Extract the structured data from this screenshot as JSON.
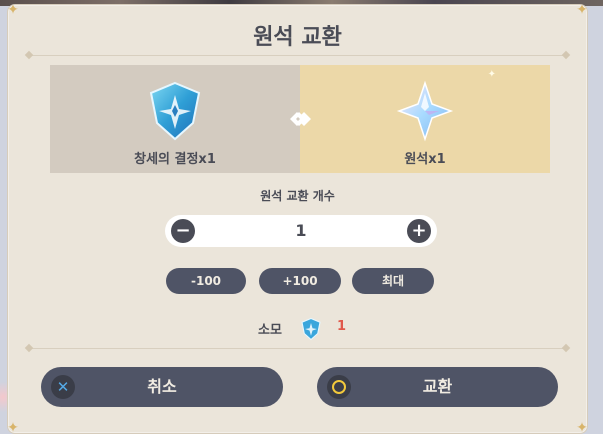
{
  "dialog": {
    "title": "원석 교환"
  },
  "exchange": {
    "from_item": {
      "label": "창세의 결정x1",
      "icon": "genesis-crystal-icon"
    },
    "arrow_icon": "exchange-arrow-icon",
    "to_item": {
      "label": "원석x1",
      "icon": "primogem-icon"
    }
  },
  "quantity": {
    "label": "원석 교환 개수",
    "value": "1",
    "minus_icon": "minus-icon",
    "plus_icon": "plus-icon"
  },
  "quick_buttons": [
    {
      "label": "-100"
    },
    {
      "label": "+100"
    },
    {
      "label": "최대"
    }
  ],
  "consume": {
    "label": "소모",
    "icon": "genesis-crystal-icon",
    "count": "1"
  },
  "actions": {
    "cancel_label": "취소",
    "cancel_icon": "close-x-icon",
    "confirm_label": "교환",
    "confirm_icon": "circle-o-icon"
  },
  "colors": {
    "dialog_bg": "#ebe5da",
    "from_bg": "#d3cbc0",
    "to_bg": "#ecd8a8",
    "button_bg": "#4f5466",
    "text": "#4a4c56",
    "consume_count": "#e0584a",
    "cancel_icon": "#54a9e6",
    "confirm_icon": "#f2c93c"
  }
}
